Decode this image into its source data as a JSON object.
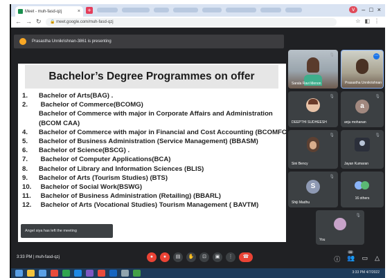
{
  "browser": {
    "tab_title": "Meet - muh-fasd-qzj",
    "tab_close": "×",
    "new_tab": "+",
    "url": "meet.google.com/muh-fasd-qzj",
    "window_controls": [
      "–",
      "□",
      "×"
    ],
    "download_badge": "v"
  },
  "meet": {
    "presenting_text": "Prasastha Unnikrishnan-3861 is presenting",
    "toast": "Angel siya has left the meeting",
    "meeting_info": "3:33 PM  |  muh-fasd-qzj",
    "people_count": "28"
  },
  "slide": {
    "title": "Bachelor’s Degree Programmes on offer",
    "programmes": [
      {
        "num": "1.",
        "text": "Bachelor of Arts(BAG) ."
      },
      {
        "num": "2.",
        "text": " Bachelor of Commerce(BCOMG)"
      },
      {
        "num": "3.",
        "text": "Bachelor of Commerce with major in Corporate Affairs and Administration (BCOM CAA)"
      },
      {
        "num": "4.",
        "text": "Bachelor of Commerce with major in Financial and Cost Accounting (BCOMFCA)"
      },
      {
        "num": "5.",
        "text": "Bachelor of Business Administration (Service Management) (BBASM)"
      },
      {
        "num": "6.",
        "text": "Bachelor of Science(BSCG) ."
      },
      {
        "num": "7.",
        "text": " Bachelor of Computer Applications(BCA)"
      },
      {
        "num": "8.",
        "text": "Bachelor of Library and Information Sciences (BLIS)"
      },
      {
        "num": "9.",
        "text": "Bachelor of Arts (Tourism Studies) (BTS)"
      },
      {
        "num": "10.",
        "text": " Bachelor of Social Work(BSWG)"
      },
      {
        "num": "11.",
        "text": "  Bachelor of Business Administration (Retailing) (BBARL)"
      },
      {
        "num": "12.",
        "text": "  Bachelor of Arts (Vocational Studies) Tourism Management   ( BAVTM)"
      }
    ]
  },
  "participants": [
    {
      "name": "Sarala Ravi Menon",
      "kind": "photo"
    },
    {
      "name": "Prasastha Unnikrishnan",
      "kind": "photo"
    },
    {
      "name": "DEEPTHI SUDHEESH",
      "kind": "photo"
    },
    {
      "name": "anju mohanan",
      "kind": "avatar",
      "initial": "a",
      "color": "#a1887f"
    },
    {
      "name": "Sini Bency",
      "kind": "photo"
    },
    {
      "name": "Jayan Kumaran",
      "kind": "photo"
    },
    {
      "name": "Shiji Madhu",
      "kind": "avatar",
      "initial": "S",
      "color": "#8e99b3"
    },
    {
      "name": "16 others",
      "kind": "others"
    },
    {
      "name": "You",
      "kind": "photo"
    }
  ],
  "icons": {
    "mic": "mic-icon",
    "camera": "camera-icon",
    "present": "present-icon",
    "hand": "raise-hand-icon",
    "more": "more-icon",
    "end": "end-call-icon",
    "info": "info-icon",
    "people": "people-icon",
    "chat": "chat-icon",
    "activities": "activities-icon"
  },
  "taskbar": {
    "time": "3:33 PM",
    "date": "4/7/2022"
  },
  "colors": {
    "meet_bg": "#202124",
    "tile_bg": "#3c4043",
    "end_call": "#ea4335",
    "accent": "#1a73e8"
  }
}
